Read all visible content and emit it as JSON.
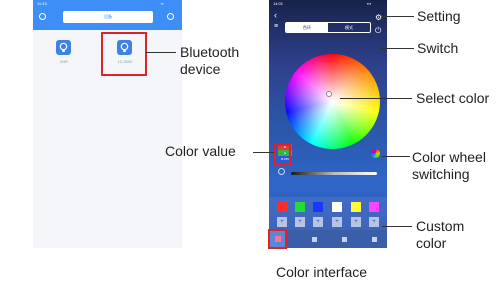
{
  "left_phone": {
    "status_time": "11:43",
    "title": "设备",
    "devices": [
      {
        "label": "WiFi",
        "icon": "lightbulb-icon"
      },
      {
        "label": "12-3000",
        "icon": "lightbulb-icon"
      }
    ]
  },
  "right_phone": {
    "status_time": "14:01",
    "tabs": [
      "色环",
      "模式"
    ],
    "color_value": {
      "r": "R",
      "g": "G",
      "b": "B:255"
    },
    "swatch_colors": [
      "#ff2a2a",
      "#22dd33",
      "#1a36ff",
      "#ffffff",
      "#ffff33",
      "#ff44ff"
    ],
    "plus_labels": [
      "+",
      "+",
      "+",
      "+",
      "+",
      "+"
    ],
    "nav_labels": [
      "",
      "",
      "",
      ""
    ]
  },
  "callouts": {
    "bluetooth_device": [
      "Bluetooth",
      "device"
    ],
    "setting": "Setting",
    "switch": "Switch",
    "select_color": "Select color",
    "color_value": "Color value",
    "color_wheel_switching": [
      "Color wheel",
      "switching"
    ],
    "custom_color": [
      "Custom",
      "color"
    ]
  },
  "caption": "Color interface",
  "accent_color": "#3d8ff7",
  "highlight_color": "#d9252a"
}
